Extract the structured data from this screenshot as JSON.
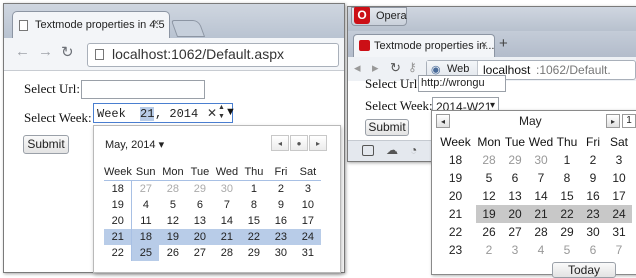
{
  "chrome": {
    "tab_title": "Textmode properties in 4.5",
    "tab_close": "×",
    "url": "localhost:1062/Default.aspx",
    "select_url_label": "Select Url:",
    "select_url_value": "",
    "select_week_label": "Select Week:",
    "week_prefix": "Week ",
    "week_number": "21",
    "week_suffix": ", 2014",
    "clear_glyph": "✕",
    "dropdown_glyph": "▼",
    "submit_label": "Submit",
    "picker": {
      "month_label": "May, 2014",
      "month_dropdown_glyph": "▾",
      "prev_glyph": "◂",
      "today_glyph": "●",
      "next_glyph": "▸",
      "headers": [
        "Week",
        "Sun",
        "Mon",
        "Tue",
        "Wed",
        "Thu",
        "Fri",
        "Sat"
      ],
      "rows": [
        {
          "week": "18",
          "days": [
            "27",
            "28",
            "29",
            "30",
            "1",
            "2",
            "3"
          ]
        },
        {
          "week": "19",
          "days": [
            "4",
            "5",
            "6",
            "7",
            "8",
            "9",
            "10"
          ]
        },
        {
          "week": "20",
          "days": [
            "11",
            "12",
            "13",
            "14",
            "15",
            "16",
            "17"
          ]
        },
        {
          "week": "21",
          "days": [
            "18",
            "19",
            "20",
            "21",
            "22",
            "23",
            "24"
          ]
        },
        {
          "week": "22",
          "days": [
            "25",
            "26",
            "27",
            "28",
            "29",
            "30",
            "31"
          ]
        }
      ],
      "selected_week": "21"
    }
  },
  "opera": {
    "menu_label": "Opera",
    "tab_title": "Textmode properties in...",
    "tab_close": "×",
    "new_tab": "+",
    "web_label": "Web",
    "url_host": "localhost",
    "url_path": ":1062/Default.",
    "select_url_label": "Select Url:",
    "select_url_value": "http://wrongu",
    "select_week_label": "Select Week:",
    "week_value": "2014-W21",
    "week_dropdown_glyph": "▾",
    "submit_label": "Submit",
    "picker": {
      "month_label": "May",
      "prev_glyph": "◂",
      "next_glyph": "▸",
      "headers": [
        "Week",
        "Mon",
        "Tue",
        "Wed",
        "Thu",
        "Fri",
        "Sat"
      ],
      "rows": [
        {
          "week": "18",
          "days": [
            "28",
            "29",
            "30",
            "1",
            "2",
            "3"
          ]
        },
        {
          "week": "19",
          "days": [
            "5",
            "6",
            "7",
            "8",
            "9",
            "10"
          ]
        },
        {
          "week": "20",
          "days": [
            "12",
            "13",
            "14",
            "15",
            "16",
            "17"
          ]
        },
        {
          "week": "21",
          "days": [
            "19",
            "20",
            "21",
            "22",
            "23",
            "24"
          ]
        },
        {
          "week": "22",
          "days": [
            "26",
            "27",
            "28",
            "29",
            "30",
            "31"
          ]
        },
        {
          "week": "23",
          "days": [
            "2",
            "3",
            "4",
            "5",
            "6",
            "7"
          ]
        }
      ],
      "selected_week": "21",
      "today_label": "Today"
    }
  }
}
